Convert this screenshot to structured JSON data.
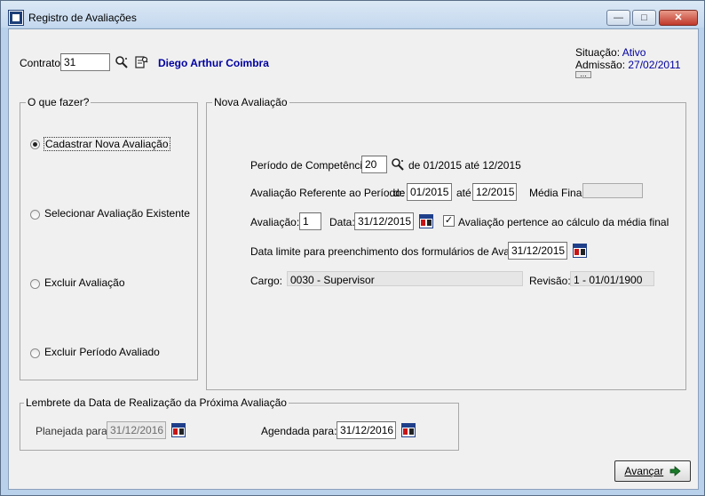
{
  "window": {
    "title": "Registro de Avaliações"
  },
  "contract": {
    "label": "Contrato:",
    "value": "31",
    "employee_name": "Diego Arthur Coimbra"
  },
  "status": {
    "situacao_label": "Situação:",
    "situacao_value": "Ativo",
    "admissao_label": "Admissão:",
    "admissao_value": "27/02/2011"
  },
  "options": {
    "legend": "O que fazer?",
    "items": [
      {
        "label": "Cadastrar Nova Avaliação",
        "selected": true
      },
      {
        "label": "Selecionar Avaliação Existente",
        "selected": false
      },
      {
        "label": "Excluir Avaliação",
        "selected": false
      },
      {
        "label": "Excluir Período Avaliado",
        "selected": false
      }
    ]
  },
  "nova": {
    "legend": "Nova Avaliação",
    "periodo_label": "Período de Competência:",
    "periodo_value": "20",
    "periodo_range": "de 01/2015 até 12/2015",
    "referente_label": "Avaliação Referente ao Período:",
    "referente_de_label": "de",
    "referente_de_value": "01/2015",
    "referente_ate_label": "até",
    "referente_ate_value": "12/2015",
    "media_label": "Média Final:",
    "media_value": "",
    "avaliacao_label": "Avaliação:",
    "avaliacao_value": "1",
    "data_label": "Data:",
    "data_value": "31/12/2015",
    "pertence_label": "Avaliação pertence ao cálculo da média final",
    "pertence_checked": true,
    "limite_label": "Data limite para preenchimento dos formulários de Avaliação:",
    "limite_value": "31/12/2015",
    "cargo_label": "Cargo:",
    "cargo_value": "0030 - Supervisor",
    "revisao_label": "Revisão:",
    "revisao_value": "1 - 01/01/1900"
  },
  "lembrete": {
    "legend": "Lembrete da Data de Realização da Próxima Avaliação",
    "planejada_label": "Planejada para:",
    "planejada_value": "31/12/2016",
    "agendada_label": "Agendada para:",
    "agendada_value": "31/12/2016"
  },
  "buttons": {
    "avancar": "Avançar"
  },
  "colors": {
    "accent_text": "#0000a0",
    "titlebar": "#c4d8ee",
    "calendar_blue": "#1f3f8a",
    "calendar_red": "#c81414",
    "arrow_green": "#1a7a2a"
  }
}
